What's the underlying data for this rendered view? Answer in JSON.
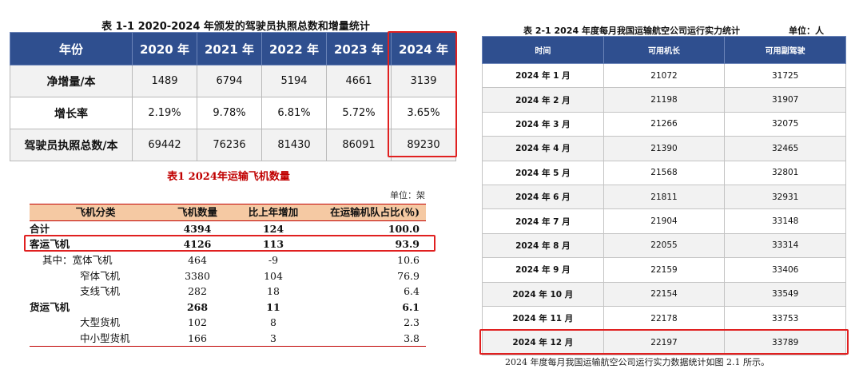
{
  "table_1_1": {
    "title": "表 1-1 2020-2024 年颁发的驾驶员执照总数和增量统计",
    "headers": [
      "年份",
      "2020 年",
      "2021 年",
      "2022 年",
      "2023 年",
      "2024 年"
    ],
    "rows": [
      {
        "label": "净增量/本",
        "values": [
          "1489",
          "6794",
          "5194",
          "4661",
          "3139"
        ]
      },
      {
        "label": "增长率",
        "values": [
          "2.19%",
          "9.78%",
          "6.81%",
          "5.72%",
          "3.65%"
        ]
      },
      {
        "label": "驾驶员执照总数/本",
        "values": [
          "69442",
          "76236",
          "81430",
          "86091",
          "89230"
        ]
      }
    ]
  },
  "table_1": {
    "title": "表1   2024年运输飞机数量",
    "unit": "单位：架",
    "headers": [
      "飞机分类",
      "飞机数量",
      "比上年增加",
      "在运输机队占比(％)"
    ],
    "rows": [
      {
        "label": "合计",
        "count": "4394",
        "increase": "124",
        "share": "100.0"
      },
      {
        "label": "客运飞机",
        "count": "4126",
        "increase": "113",
        "share": "93.9"
      },
      {
        "label": "其中：宽体飞机",
        "count": "464",
        "increase": "-9",
        "share": "10.6"
      },
      {
        "label": "窄体飞机",
        "count": "3380",
        "increase": "104",
        "share": "76.9"
      },
      {
        "label": "支线飞机",
        "count": "282",
        "increase": "18",
        "share": "6.4"
      },
      {
        "label": "货运飞机",
        "count": "268",
        "increase": "11",
        "share": "6.1"
      },
      {
        "label": "大型货机",
        "count": "102",
        "increase": "8",
        "share": "2.3"
      },
      {
        "label": "中小型货机",
        "count": "166",
        "increase": "3",
        "share": "3.8"
      }
    ]
  },
  "table_2_1": {
    "title": "表 2-1  2024 年度每月我国运输航空公司运行实力统计",
    "unit": "单位：人",
    "headers": [
      "时间",
      "可用机长",
      "可用副驾驶"
    ],
    "rows": [
      {
        "month": "2024 年 1 月",
        "captains": "21072",
        "first_officers": "31725"
      },
      {
        "month": "2024 年 2 月",
        "captains": "21198",
        "first_officers": "31907"
      },
      {
        "month": "2024 年 3 月",
        "captains": "21266",
        "first_officers": "32075"
      },
      {
        "month": "2024 年 4 月",
        "captains": "21390",
        "first_officers": "32465"
      },
      {
        "month": "2024 年 5 月",
        "captains": "21568",
        "first_officers": "32801"
      },
      {
        "month": "2024 年 6 月",
        "captains": "21811",
        "first_officers": "32931"
      },
      {
        "month": "2024 年 7 月",
        "captains": "21904",
        "first_officers": "33148"
      },
      {
        "month": "2024 年 8 月",
        "captains": "22055",
        "first_officers": "33314"
      },
      {
        "month": "2024 年 9 月",
        "captains": "22159",
        "first_officers": "33406"
      },
      {
        "month": "2024 年 10 月",
        "captains": "22154",
        "first_officers": "33549"
      },
      {
        "month": "2024 年 11 月",
        "captains": "22178",
        "first_officers": "33753"
      },
      {
        "month": "2024 年 12 月",
        "captains": "22197",
        "first_officers": "33789"
      }
    ],
    "caption": "2024 年度每月我国运输航空公司运行实力数据统计如图 2.1 所示。"
  },
  "colors": {
    "header_blue": "#2f4f8f",
    "highlight_red": "#e02020",
    "table1_header": "#f5c9a3",
    "table1_title": "#c00000"
  }
}
